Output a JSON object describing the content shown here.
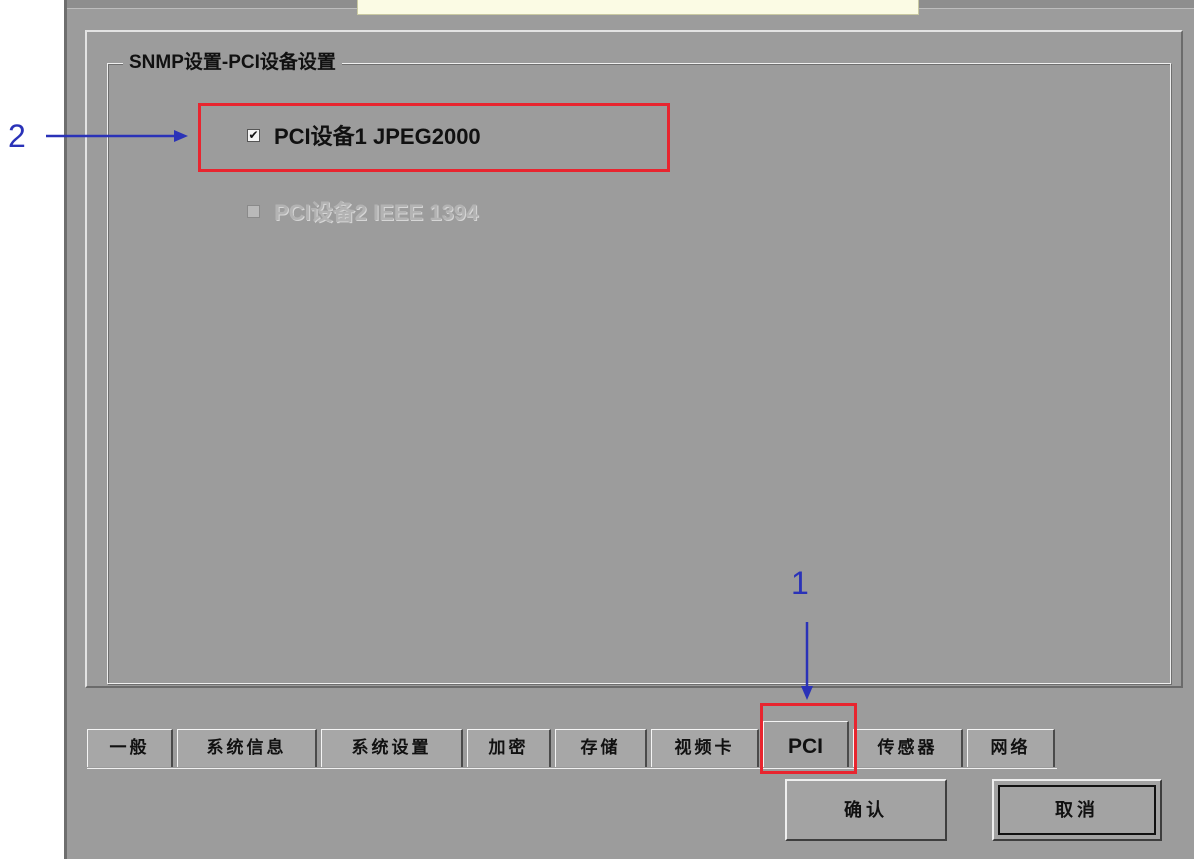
{
  "group": {
    "title": "SNMP设置-PCI设备设置"
  },
  "devices": [
    {
      "label": "PCI设备1 JPEG2000",
      "checked": true,
      "enabled": true
    },
    {
      "label": "PCI设备2 IEEE 1394",
      "checked": false,
      "enabled": false
    }
  ],
  "tabs": [
    {
      "label": "一般",
      "active": false
    },
    {
      "label": "系统信息",
      "active": false
    },
    {
      "label": "系统设置",
      "active": false
    },
    {
      "label": "加密",
      "active": false
    },
    {
      "label": "存储",
      "active": false
    },
    {
      "label": "视频卡",
      "active": false
    },
    {
      "label": "PCI",
      "active": true
    },
    {
      "label": "传感器",
      "active": false
    },
    {
      "label": "网络",
      "active": false
    }
  ],
  "buttons": {
    "confirm_label": "确认",
    "cancel_label": "取消"
  },
  "annotations": {
    "callout_1": "1",
    "callout_2": "2",
    "highlight_color": "#e8252f",
    "arrow_color": "#2a32b8"
  },
  "check_glyph": "✔"
}
